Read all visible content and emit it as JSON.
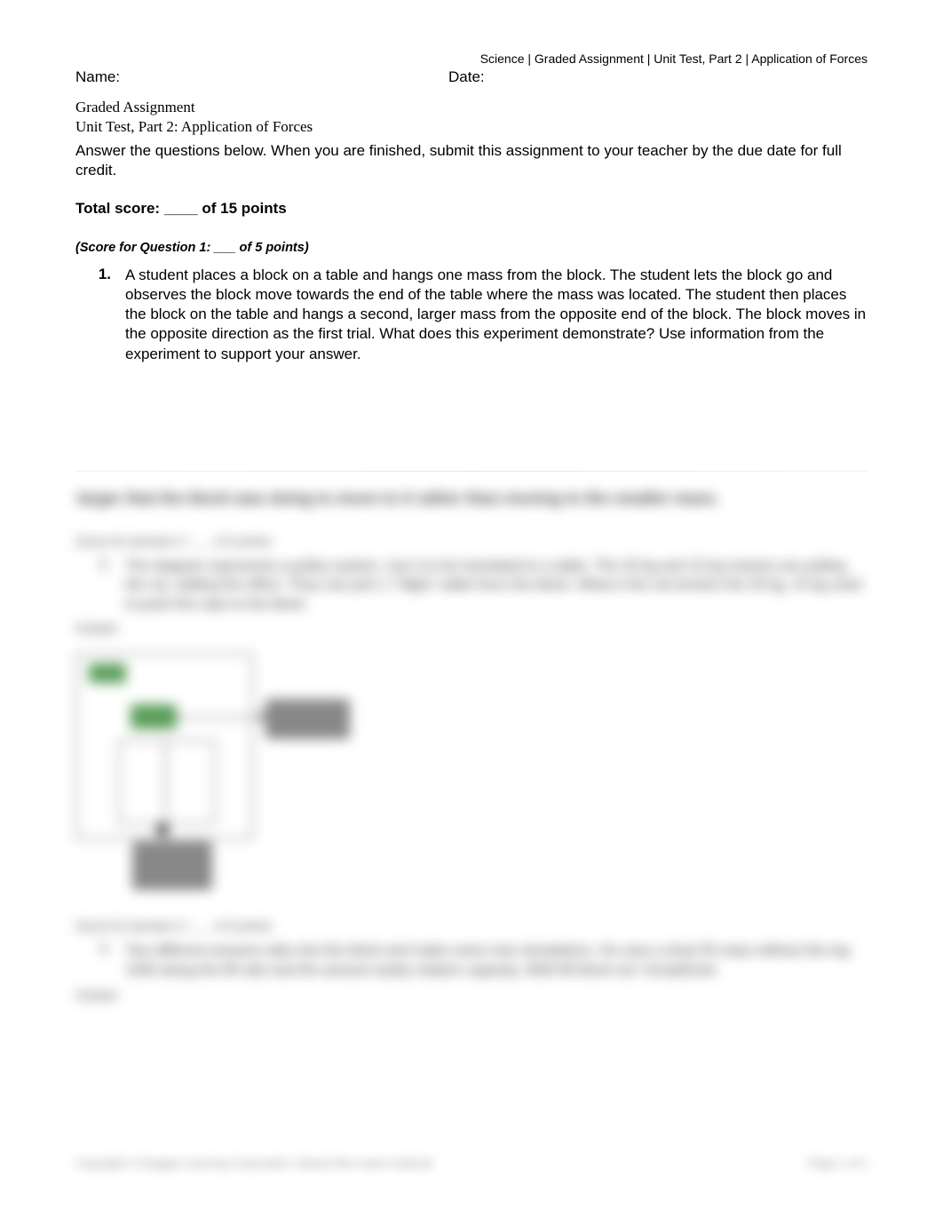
{
  "header": {
    "breadcrumb": "Science | Graded Assignment | Unit Test, Part 2 | Application of Forces",
    "name_label": "Name:",
    "date_label": "Date:"
  },
  "titles": {
    "assignment": "Graded Assignment",
    "unit": "Unit Test, Part 2: Application of Forces"
  },
  "instructions": "Answer the questions below. When you are finished, submit this assignment to your teacher by the due date for full credit.",
  "total_score": "Total score: ____ of 15 points",
  "q1": {
    "score_line": "(Score for Question 1: ___ of 5 points)",
    "number": "1.",
    "text": "A student places a block on a table and hangs one mass from the block. The student lets the block go and observes the block move towards the end of the table where the mass was located. The student then places the block on the table and hangs a second, larger mass from the opposite end of the block. The block moves in the opposite direction as the first trial. What does this experiment demonstrate? Use information from the experiment to support your answer."
  },
  "blurred": {
    "line1": "larger that the block was doing to move to it rather than moving to the smaller mass.",
    "q2_score": "(Score for Question 2: ___ of 5 points)",
    "q2_num": "2.",
    "q2_text": "The diagram represents a pulley system. Use it to be translated to a table. The 20 kg and 15 kg masses are pulling the car, adding the effect. They can pull 1.7 flight / table force the block. What is the net tension the 20 kg, 15 kg used to push the rope to the block.",
    "answer_label": "Answer:",
    "q3_score": "(Score for Question 3: ___ of 5 points)",
    "q3_num": "3.",
    "q3_text": "Two different answers take into the block and make some new simulations. He uses a drop 50 mass without the top. 1500 along the lift rails and the amount easily rotation capacity, 4000 lift block out / broadened.",
    "answer_label2": "Answer:"
  },
  "footer": {
    "left": "Copyright © Engage Learning Corporation. Based their same material.",
    "right": "Page 1 of 2"
  }
}
